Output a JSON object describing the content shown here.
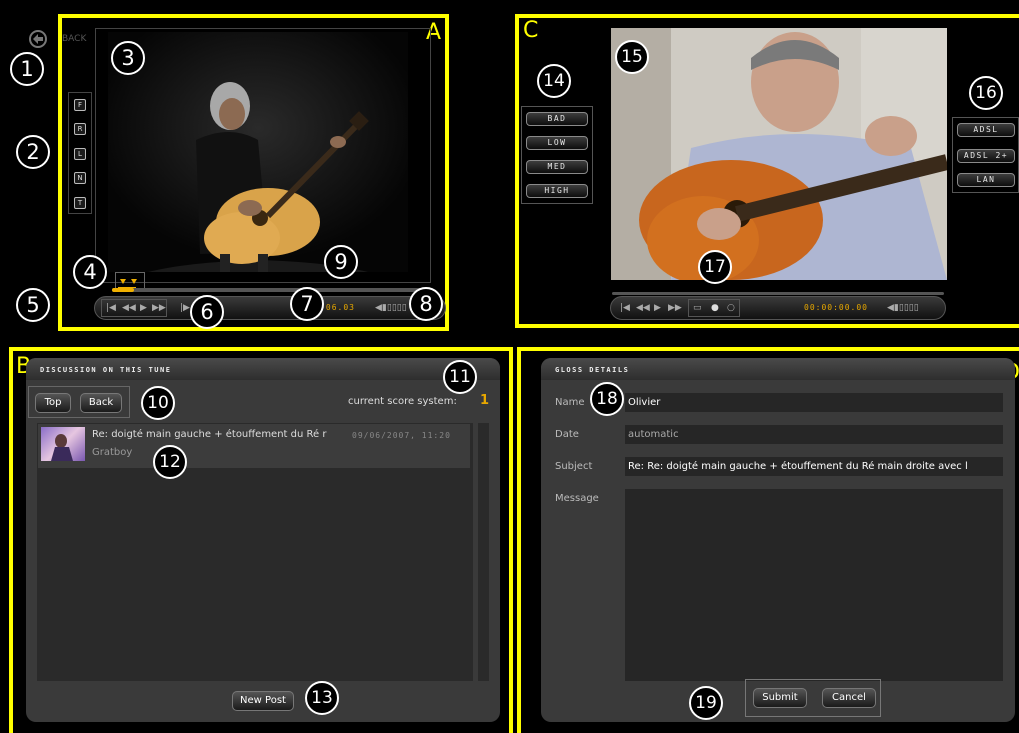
{
  "sections": {
    "a": "A",
    "b": "B",
    "c": "C",
    "d": "D"
  },
  "callouts": [
    "1",
    "2",
    "3",
    "4",
    "5",
    "6",
    "7",
    "8",
    "9",
    "10",
    "11",
    "12",
    "13",
    "14",
    "15",
    "16",
    "17",
    "18",
    "19"
  ],
  "player_a": {
    "back_label": "BACK",
    "side_buttons": [
      "F",
      "R",
      "L",
      "N",
      "T"
    ],
    "timecode": "00:00:06.03",
    "transport_icons": [
      "skip-back-icon",
      "rewind-icon",
      "play-icon",
      "fast-forward-icon"
    ]
  },
  "player_c": {
    "quality_buttons": [
      "BAD",
      "LOW",
      "MED",
      "HIGH"
    ],
    "connection_buttons": [
      "ADSL",
      "ADSL 2+",
      "LAN"
    ],
    "timecode": "00:00:00.00"
  },
  "discussion": {
    "title": "DISCUSSION ON THIS TUNE",
    "top_button": "Top",
    "back_button": "Back",
    "score_label": "current score system:",
    "score_value": "1",
    "posts": [
      {
        "subject": "Re: doigté main gauche + étouffement du Ré r",
        "date": "09/06/2007, 11:20",
        "author": "Gratboy"
      }
    ],
    "new_post_button": "New Post"
  },
  "gloss": {
    "title": "GLOSS DETAILS",
    "name_label": "Name",
    "name_value": "Olivier",
    "date_label": "Date",
    "date_value": "automatic",
    "subject_label": "Subject",
    "subject_value": "Re: Re: doigté main gauche + étouffement du Ré main droite avec l",
    "message_label": "Message",
    "message_value": "",
    "submit_button": "Submit",
    "cancel_button": "Cancel"
  },
  "colors": {
    "highlight": "#ffff00",
    "accent": "#e8a800",
    "panel": "#3a3a3a",
    "field": "#262626"
  }
}
